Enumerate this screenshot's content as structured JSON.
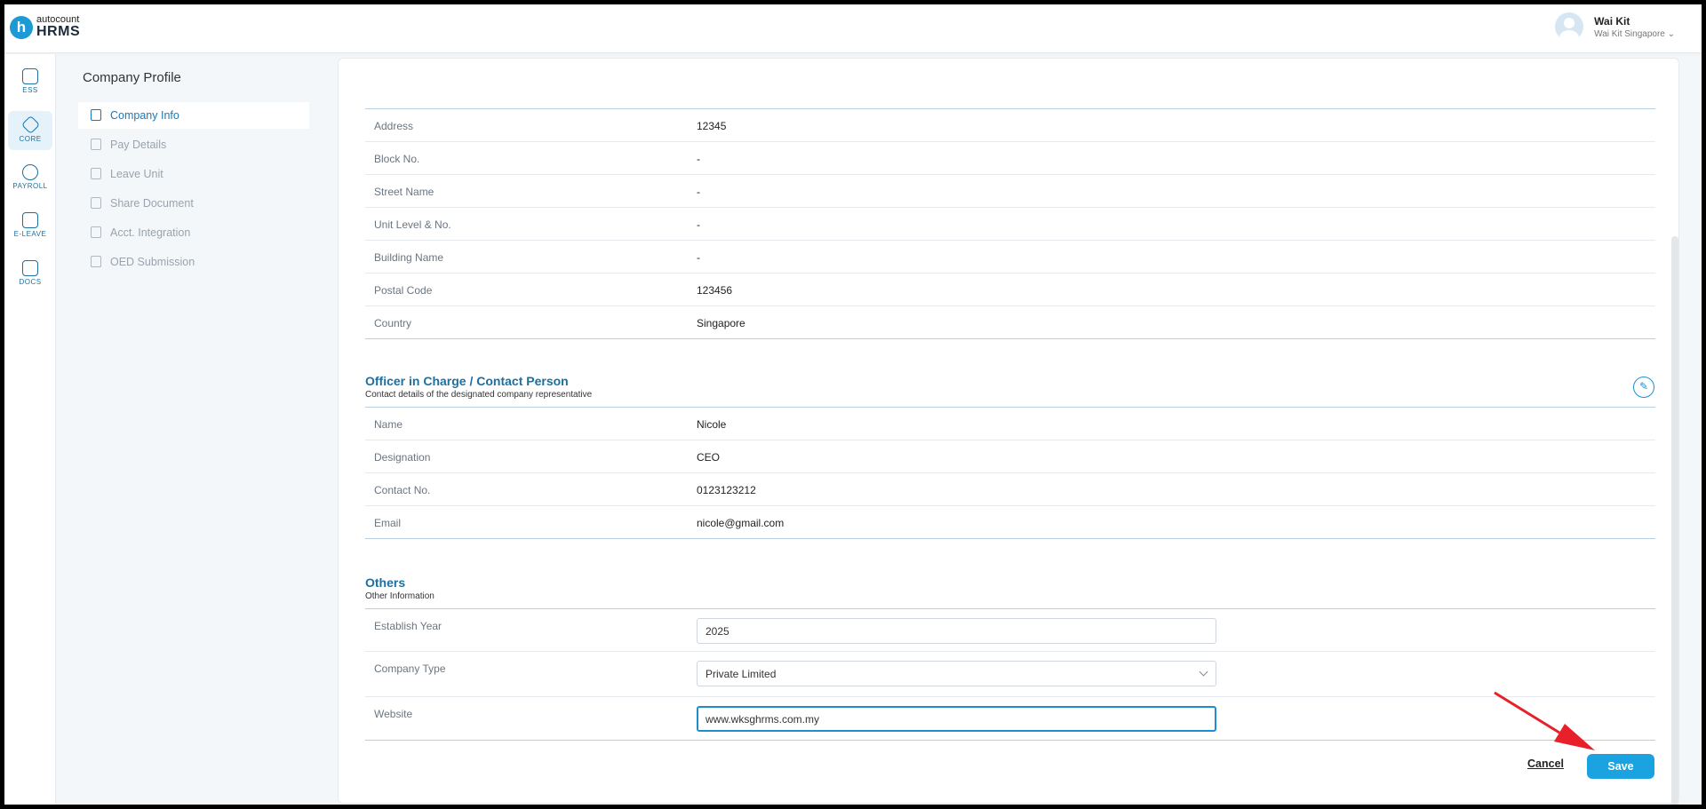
{
  "app": {
    "logo_small": "autocount",
    "logo_big": "HRMS",
    "logo_letter": "h"
  },
  "user": {
    "name": "Wai Kit",
    "org": "Wai Kit Singapore ⌄"
  },
  "rail": [
    {
      "label": "ESS"
    },
    {
      "label": "CORE"
    },
    {
      "label": "PAYROLL"
    },
    {
      "label": "E-LEAVE"
    },
    {
      "label": "DOCS"
    }
  ],
  "page_title": "Company Profile",
  "subnav": [
    {
      "label": "Company Info"
    },
    {
      "label": "Pay Details"
    },
    {
      "label": "Leave Unit"
    },
    {
      "label": "Share Document"
    },
    {
      "label": "Acct. Integration"
    },
    {
      "label": "OED Submission"
    }
  ],
  "address_rows": [
    {
      "label": "Address",
      "value": "12345"
    },
    {
      "label": "Block No.",
      "value": "-"
    },
    {
      "label": "Street Name",
      "value": "-"
    },
    {
      "label": "Unit Level & No.",
      "value": "-"
    },
    {
      "label": "Building Name",
      "value": "-"
    },
    {
      "label": "Postal Code",
      "value": "123456"
    },
    {
      "label": "Country",
      "value": "Singapore"
    }
  ],
  "officer": {
    "title": "Officer in Charge / Contact Person",
    "subtitle": "Contact details of the designated company representative",
    "rows": [
      {
        "label": "Name",
        "value": "Nicole"
      },
      {
        "label": "Designation",
        "value": "CEO"
      },
      {
        "label": "Contact No.",
        "value": "0123123212"
      },
      {
        "label": "Email",
        "value": "nicole@gmail.com"
      }
    ]
  },
  "others": {
    "title": "Others",
    "subtitle": "Other Information",
    "establish_label": "Establish Year",
    "establish_value": "2025",
    "company_type_label": "Company Type",
    "company_type_value": "Private Limited",
    "website_label": "Website",
    "website_value": "www.wksghrms.com.my"
  },
  "actions": {
    "cancel": "Cancel",
    "save": "Save"
  },
  "colors": {
    "accent": "#1aa3e0",
    "section_title": "#1c6fa0",
    "annotation_arrow": "#e8202a"
  }
}
